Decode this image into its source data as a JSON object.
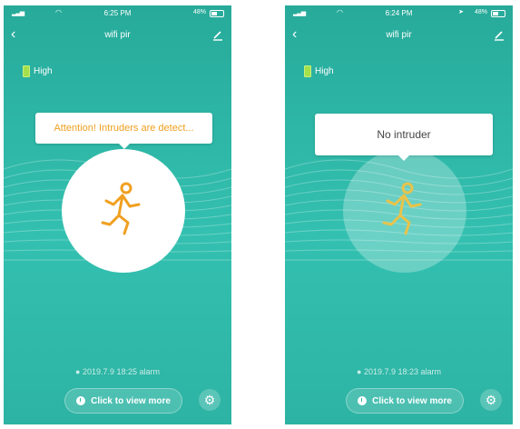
{
  "screens": [
    {
      "status": {
        "time": "6:25 PM",
        "battery": "48%"
      },
      "nav": {
        "title": "wifi pir"
      },
      "battery_level": "High",
      "message": "Attention! Intruders are detect...",
      "alarm": "2019.7.9 18:25 alarm",
      "view_more": "Click to view more",
      "runner_color": "#f0a020"
    },
    {
      "status": {
        "time": "6:24 PM",
        "battery": "48%"
      },
      "nav": {
        "title": "wifi pir"
      },
      "battery_level": "High",
      "message": "No intruder",
      "alarm": "2019.7.9 18:23 alarm",
      "view_more": "Click to view more",
      "runner_color": "#e8c34a"
    }
  ],
  "colors": {
    "background_teal": "#2fb8a8",
    "alert_orange": "#f0a020"
  },
  "icons": {
    "back": "chevron-left-icon",
    "edit": "pencil-icon",
    "settings": "gear-icon",
    "clock": "clock-icon"
  }
}
